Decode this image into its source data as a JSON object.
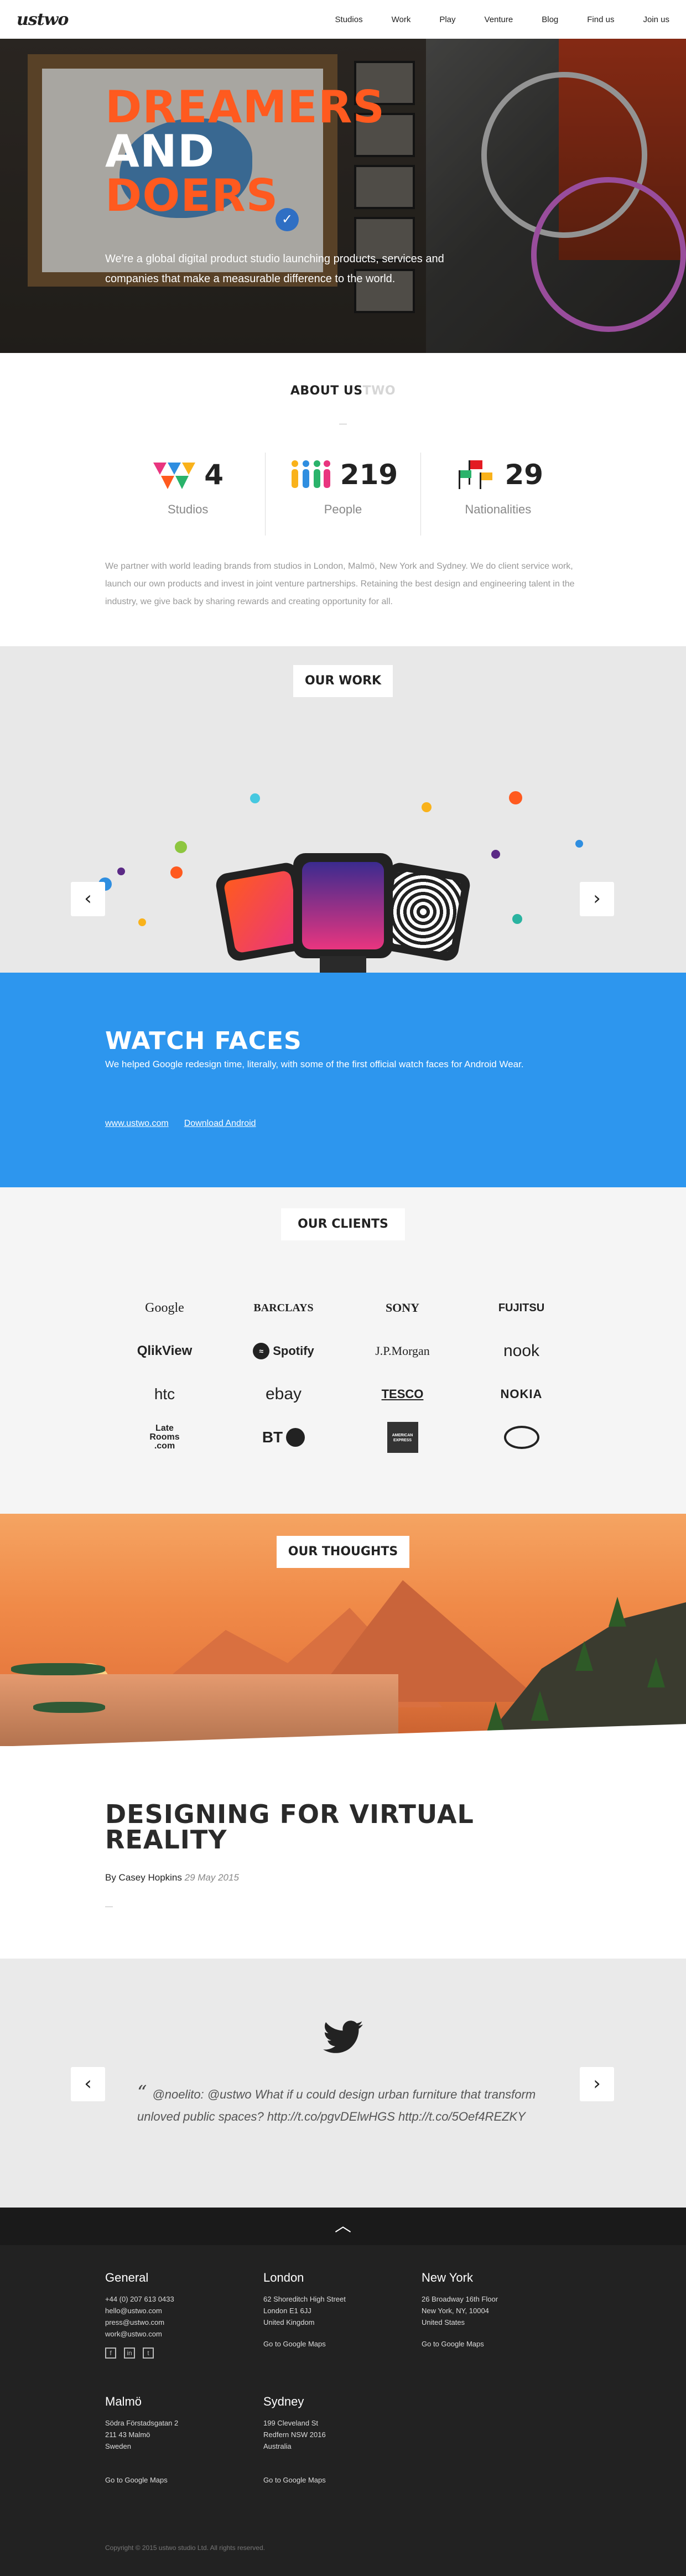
{
  "nav": {
    "logo": "ustwo",
    "links": [
      "Studios",
      "Work",
      "Play",
      "Venture",
      "Blog",
      "Find us",
      "Join us"
    ]
  },
  "hero": {
    "line1": "DREAMERS",
    "line2": "AND",
    "line3": "DOERS",
    "subtitle": "We're a global digital product studio launching products, services and companies that make a measurable difference to the world.",
    "colors": {
      "accent": "#ff5a1f"
    }
  },
  "about": {
    "title_main": "ABOUT US",
    "title_ghost": "TWO",
    "stats": [
      {
        "number": "4",
        "label": "Studios",
        "icon": "triangles-icon"
      },
      {
        "number": "219",
        "label": "People",
        "icon": "people-icon"
      },
      {
        "number": "29",
        "label": "Nationalities",
        "icon": "flags-icon"
      }
    ],
    "paragraph": "We partner with world leading brands from studios in London, Malmö, New York and Sydney. We do client service work, launch our own products and invest in joint venture partnerships. Retaining the best design and engineering talent in the industry, we give back by sharing rewards and creating opportunity for all."
  },
  "work": {
    "label": "OUR WORK",
    "project_title": "WATCH FACES",
    "project_desc": "We helped Google redesign time, literally, with some of the first official watch faces for Android Wear.",
    "links": [
      "www.ustwo.com",
      "Download Android"
    ],
    "prev_icon": "‹",
    "next_icon": "›",
    "colors": {
      "blue": "#2d96ee"
    }
  },
  "clients": {
    "label": "OUR CLIENTS",
    "logos": [
      "Google",
      "BARCLAYS",
      "SONY",
      "FUJITSU",
      "QlikView",
      "Spotify",
      "J.P.Morgan",
      "nook",
      "htc",
      "ebay",
      "TESCO",
      "NOKIA",
      "Late Rooms .com",
      "BT",
      "AMERICAN EXPRESS",
      "TOYOTA"
    ]
  },
  "thoughts": {
    "label": "OUR THOUGHTS",
    "post_title": "DESIGNING FOR VIRTUAL REALITY",
    "author": "By Casey Hopkins",
    "date": "29 May 2015"
  },
  "twitter": {
    "tweet": "@noelito: @ustwo What if u could design urban furniture that transform unloved public spaces? http://t.co/pgvDElwHGS http://t.co/5Oef4REZKY"
  },
  "footer": {
    "offices": [
      {
        "name": "General",
        "lines": [
          "+44 (0) 207 613 0433",
          "hello@ustwo.com",
          "press@ustwo.com",
          "work@ustwo.com"
        ]
      },
      {
        "name": "London",
        "lines": [
          "62 Shoreditch High Street",
          "London E1 6JJ",
          "United Kingdom"
        ],
        "maps": "Go to Google Maps"
      },
      {
        "name": "New York",
        "lines": [
          "26 Broadway 16th Floor",
          "New York, NY, 10004",
          "United States"
        ],
        "maps": "Go to Google Maps"
      },
      {
        "name": "Malmö",
        "lines": [
          "Södra Förstadsgatan 2",
          "211 43 Malmö",
          "Sweden"
        ],
        "maps": "Go to Google Maps"
      },
      {
        "name": "Sydney",
        "lines": [
          "199 Cleveland St",
          "Redfern NSW 2016",
          "Australia"
        ],
        "maps": "Go to Google Maps"
      }
    ],
    "social": [
      "facebook-icon",
      "linkedin-icon",
      "twitter-icon"
    ],
    "copyright": "Copyright © 2015 ustwo studio Ltd. All rights reserved."
  }
}
